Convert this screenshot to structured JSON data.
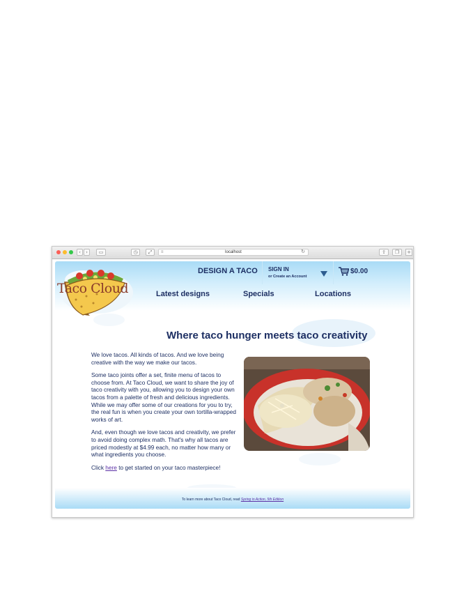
{
  "browser": {
    "url": "localhost"
  },
  "header": {
    "brand": "Taco Cloud",
    "design_link": "DESIGN A TACO",
    "sign_in": "SIGN IN",
    "create_account": "or Create an Account",
    "cart_total": "$0.00",
    "nav": [
      "Latest designs",
      "Specials",
      "Locations"
    ]
  },
  "main": {
    "headline": "Where taco hunger meets taco creativity",
    "paragraphs": [
      "We love tacos. All kinds of tacos. And we love being creative with the way we make our tacos.",
      "Some taco joints offer a set, finite menu of tacos to choose from. At Taco Cloud, we want to share the joy of taco creativity with you, allowing you to design your own tacos from a palette of fresh and delicious ingredients. While we may offer some of our creations for you to try, the real fun is when you create your own tortilla-wrapped works of art.",
      "And, even though we love tacos and creativity, we prefer to avoid doing complex math. That's why all tacos are priced modestly at $4.99 each, no matter how many or what ingredients you choose."
    ],
    "cta_prefix": "Click ",
    "cta_link": "here",
    "cta_suffix": " to get started on your taco masterpiece!"
  },
  "footer": {
    "text": "To learn more about Taco Cloud, read ",
    "link": "Spring in Action, 5th Edition"
  },
  "colors": {
    "navy": "#1d2f63",
    "sky": "#a9dbf6",
    "link": "#5a2fa5"
  }
}
